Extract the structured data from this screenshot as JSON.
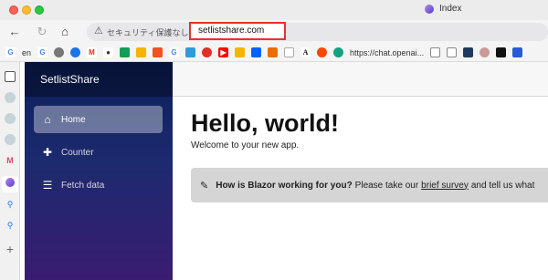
{
  "browser": {
    "tab_title": "Index",
    "security_label": "セキュリティ保護なし",
    "url": "setlistshare.com",
    "bookmarks": {
      "gen_label": "en",
      "chat_label": "https://chat.openai..."
    }
  },
  "app": {
    "brand": "SetlistShare",
    "nav": [
      {
        "label": "Home",
        "icon": "home-icon"
      },
      {
        "label": "Counter",
        "icon": "plus-icon"
      },
      {
        "label": "Fetch data",
        "icon": "list-icon"
      }
    ],
    "page": {
      "heading": "Hello, world!",
      "welcome": "Welcome to your new app.",
      "survey": {
        "question": "How is Blazor working for you?",
        "pre_link": "Please take our",
        "link": "brief survey",
        "post_link": "and tell us what"
      }
    }
  },
  "colors": {
    "url_highlight": "#e5322d",
    "sidebar_top": "#0b1f57",
    "sidebar_bottom": "#3a1c71"
  }
}
